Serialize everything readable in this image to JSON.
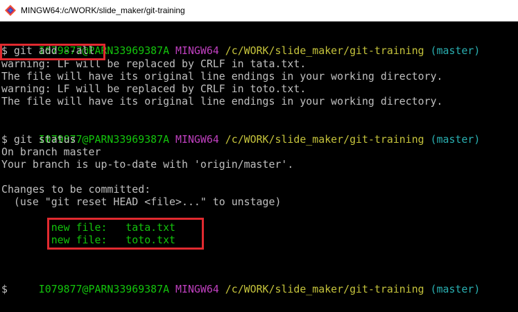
{
  "window": {
    "title": "MINGW64:/c/WORK/slide_maker/git-training",
    "icon": "git-bash-icon"
  },
  "colors": {
    "prompt_user": "#13c40c",
    "prompt_env": "#c040c0",
    "prompt_path": "#c6c43c",
    "prompt_branch": "#2ab1b3",
    "text": "#c0c0c0",
    "staged": "#13c40c",
    "highlight": "#e12a2f"
  },
  "terminal": {
    "prompt1": {
      "user": "I079877@PARN33969387A",
      "env": "MINGW64",
      "path": "/c/WORK/slide_maker/git-training",
      "branch": "(master)"
    },
    "command1": "$ git add --all",
    "warn1": "warning: LF will be replaced by CRLF in tata.txt.",
    "info1": "The file will have its original line endings in your working directory.",
    "warn2": "warning: LF will be replaced by CRLF in toto.txt.",
    "info2": "The file will have its original line endings in your working directory.",
    "prompt2": {
      "user": "I079877@PARN33969387A",
      "env": "MINGW64",
      "path": "/c/WORK/slide_maker/git-training",
      "branch": "(master)"
    },
    "command2": "$ git status",
    "status1": "On branch master",
    "status2": "Your branch is up-to-date with 'origin/master'.",
    "status3": "Changes to be committed:",
    "status4": "  (use \"git reset HEAD <file>...\" to unstage)",
    "staged": [
      "        new file:   tata.txt",
      "        new file:   toto.txt"
    ],
    "prompt3": {
      "user": "I079877@PARN33969387A",
      "env": "MINGW64",
      "path": "/c/WORK/slide_maker/git-training",
      "branch": "(master)"
    },
    "cursor_prompt": "$"
  }
}
